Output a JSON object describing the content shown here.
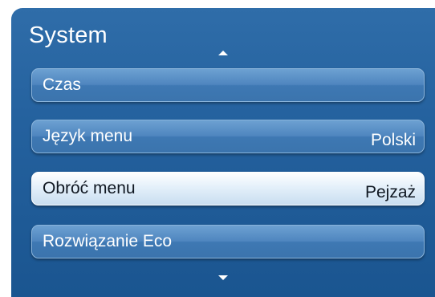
{
  "menu": {
    "title": "System",
    "scroll_up_icon": "triangle-up-icon",
    "scroll_down_icon": "triangle-down-icon",
    "items": [
      {
        "label": "Czas",
        "value": ""
      },
      {
        "label": "Język menu",
        "value": "Polski"
      },
      {
        "label": "Obróć menu",
        "value": "Pejzaż",
        "selected": true
      },
      {
        "label": "Rozwiązanie Eco",
        "value": ""
      }
    ]
  },
  "colors": {
    "panel_background": "#24619e",
    "item_background": "#4f86bf",
    "selected_item_background": "#e4f0fa",
    "text": "#ffffff",
    "selected_text": "#101822"
  }
}
